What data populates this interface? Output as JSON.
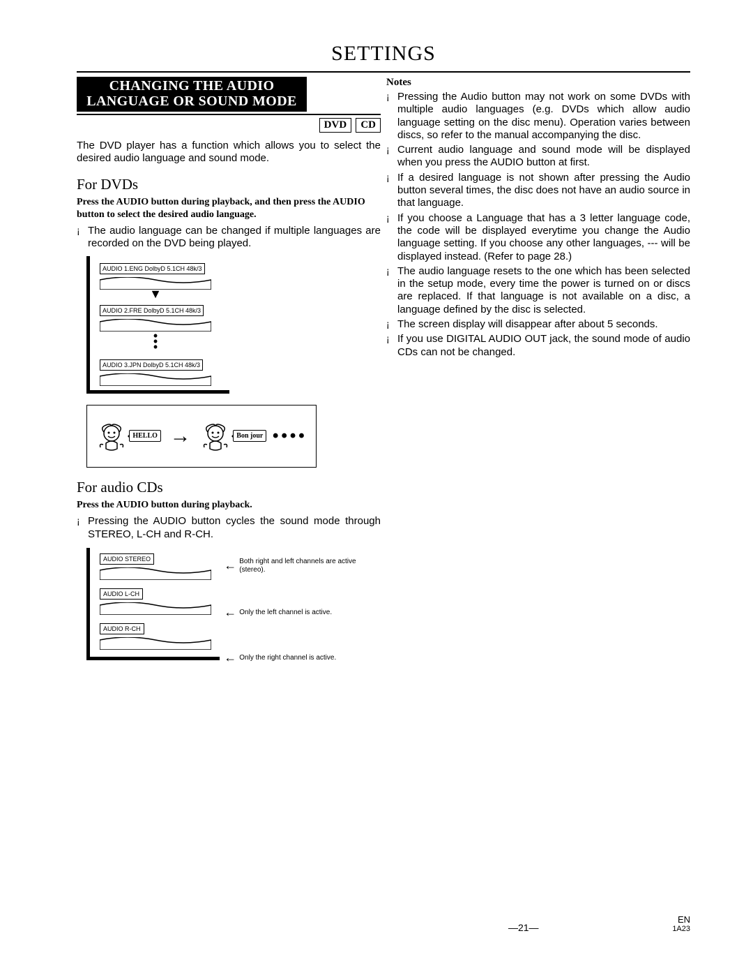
{
  "title": "SETTINGS",
  "section_heading_line1": "CHANGING THE AUDIO",
  "section_heading_line2": "LANGUAGE OR SOUND MODE",
  "media": {
    "dvd": "DVD",
    "cd": "CD"
  },
  "intro": "The DVD player has a function which allows you to select the desired audio language and sound mode.",
  "for_dvds": {
    "heading": "For DVDs",
    "instr": "Press the AUDIO button during playback, and then press the AUDIO button to select the desired audio language.",
    "bullet": "The audio language can be changed if multiple languages are recorded on the DVD being played.",
    "fig_labels": [
      "AUDIO 1.ENG DolbyD 5.1CH 48k/3",
      "AUDIO 2.FRE DolbyD 5.1CH 48k/3",
      "AUDIO 3.JPN DolbyD 5.1CH 48k/3"
    ],
    "speech1": "HELLO",
    "speech2": "Bon jour"
  },
  "for_cds": {
    "heading": "For audio CDs",
    "instr": "Press the AUDIO button during playback.",
    "bullet": "Pressing the AUDIO button cycles the sound mode through STEREO, L-CH and R-CH.",
    "modes": [
      {
        "label": "AUDIO STEREO",
        "desc": "Both right and left channels are active (stereo)."
      },
      {
        "label": "AUDIO L-CH",
        "desc": "Only the left channel is active."
      },
      {
        "label": "AUDIO R-CH",
        "desc": "Only the right channel is active."
      }
    ]
  },
  "notes_heading": "Notes",
  "notes": [
    "Pressing the Audio button may not work on some DVDs with multiple audio languages (e.g. DVDs which allow audio language setting on the disc menu). Operation varies between discs, so refer to the manual accompanying the disc.",
    "Current audio language and sound mode will be displayed when you press the AUDIO button at first.",
    "If a desired language is not shown after pressing the Audio button several times, the disc does not have an audio source in that language.",
    "If you choose a Language that has a 3 letter language code, the code will be displayed everytime you change the Audio language setting. If you choose any other languages, --- will be displayed instead. (Refer to page 28.)",
    "The audio language resets to the one which has been selected in the setup mode, every time the power is turned on or discs are replaced. If that language is not available on a disc, a language defined by the disc is selected.",
    "The screen display will disappear after about 5 seconds.",
    "If you use DIGITAL AUDIO OUT jack, the sound mode of audio CDs can not be changed."
  ],
  "footer": {
    "page": "21",
    "lang": "EN",
    "code": "1A23"
  }
}
